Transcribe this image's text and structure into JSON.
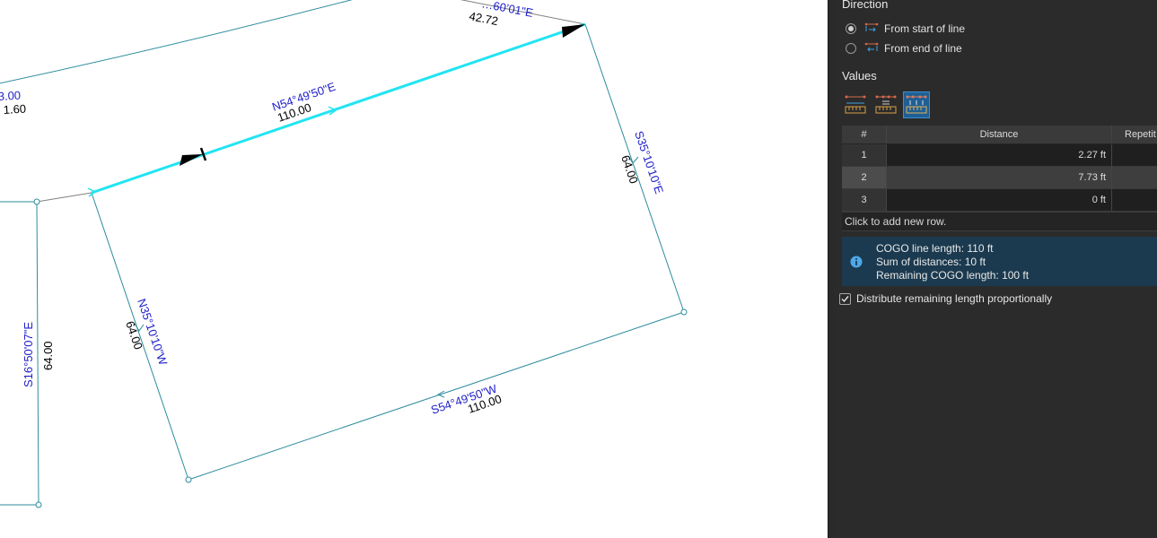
{
  "map": {
    "segments": {
      "top_right": {
        "bearing": "",
        "distance": "42.72",
        "bearing_partial": "…60’01\"E"
      },
      "selected": {
        "bearing": "N54°49'50\"E",
        "distance": "110.00"
      },
      "right": {
        "bearing": "S35°10'10\"E",
        "distance": "64.00"
      },
      "bottom": {
        "bearing": "S54°49'50\"W",
        "distance": "110.00"
      },
      "left": {
        "bearing": "N35°10'10\"W",
        "distance": "64.00"
      },
      "far_left": {
        "bearing": "S16°50'07\"E",
        "distance": "64.00"
      },
      "arc": {
        "bearing": "3.00",
        "distance": "1.60"
      }
    },
    "colors": {
      "parcel_line": "#2d8c9e",
      "selected_line": "#22e4f2",
      "bearing_text": "#1e1ec8",
      "distance_text": "#000000"
    }
  },
  "panel": {
    "direction": {
      "title": "Direction",
      "options": [
        {
          "label": "From start of line",
          "selected": true,
          "icon": "from-start-icon"
        },
        {
          "label": "From end of line",
          "selected": false,
          "icon": "from-end-icon"
        }
      ]
    },
    "values": {
      "title": "Values",
      "modes": [
        {
          "icon": "distance-ruler-icon",
          "active": false
        },
        {
          "icon": "equal-split-ruler-icon",
          "active": false
        },
        {
          "icon": "multiple-distances-ruler-icon",
          "active": true
        }
      ]
    },
    "table": {
      "columns": [
        "#",
        "Distance",
        "Repetit"
      ],
      "rows": [
        {
          "index": "1",
          "distance": "2.27 ft",
          "repetitions": ""
        },
        {
          "index": "2",
          "distance": "7.73 ft",
          "repetitions": ""
        },
        {
          "index": "3",
          "distance": "0 ft",
          "repetitions": ""
        }
      ],
      "selected_row": 1,
      "add_row_label": "Click to add new row."
    },
    "info": {
      "icon": "info-icon",
      "lines": [
        "COGO line length: 110 ft",
        "Sum of distances: 10 ft",
        "Remaining COGO length: 100 ft"
      ]
    },
    "distribute": {
      "label": "Distribute remaining length proportionally",
      "checked": true
    }
  }
}
